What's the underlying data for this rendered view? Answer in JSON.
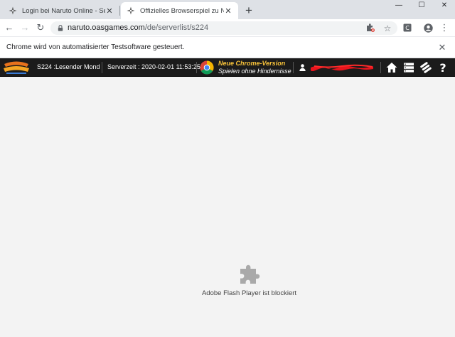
{
  "browser": {
    "tabs": [
      {
        "title": "Login bei Naruto Online - Server",
        "favicon": "naruto-favicon-icon",
        "active": false
      },
      {
        "title": "Offizielles Browserspiel zu Naruto",
        "favicon": "naruto-favicon-icon",
        "active": true
      }
    ],
    "new_tab_icon": "plus-icon",
    "window_controls": [
      "minimize-icon",
      "maximize-icon",
      "close-icon"
    ],
    "address_bar": {
      "domain": "naruto.oasgames.com",
      "path": "/de/serverlist/s224"
    }
  },
  "infobar": {
    "message": "Chrome wird von automatisierter Testsoftware gesteuert."
  },
  "gamebar": {
    "server_label": "S224 :Lesender Mond",
    "server_time_label": "Serverzeit :",
    "server_time": "2020-02-01  11:53:25",
    "promo_title": "Neue Chrome-Version",
    "promo_subtitle": "Spielen ohne Hindernisse",
    "username_redacted": true,
    "username_redaction_color": "#e8141c"
  },
  "content": {
    "plugin_message": "Adobe Flash Player ist blockiert",
    "plugin_icon": "puzzle-piece-icon"
  },
  "colors": {
    "tabbar_bg": "#dee1e6",
    "gamebar_bg": "#1b1b1b",
    "promo_title": "#f7c23a",
    "content_bg": "#f3f3f3"
  }
}
